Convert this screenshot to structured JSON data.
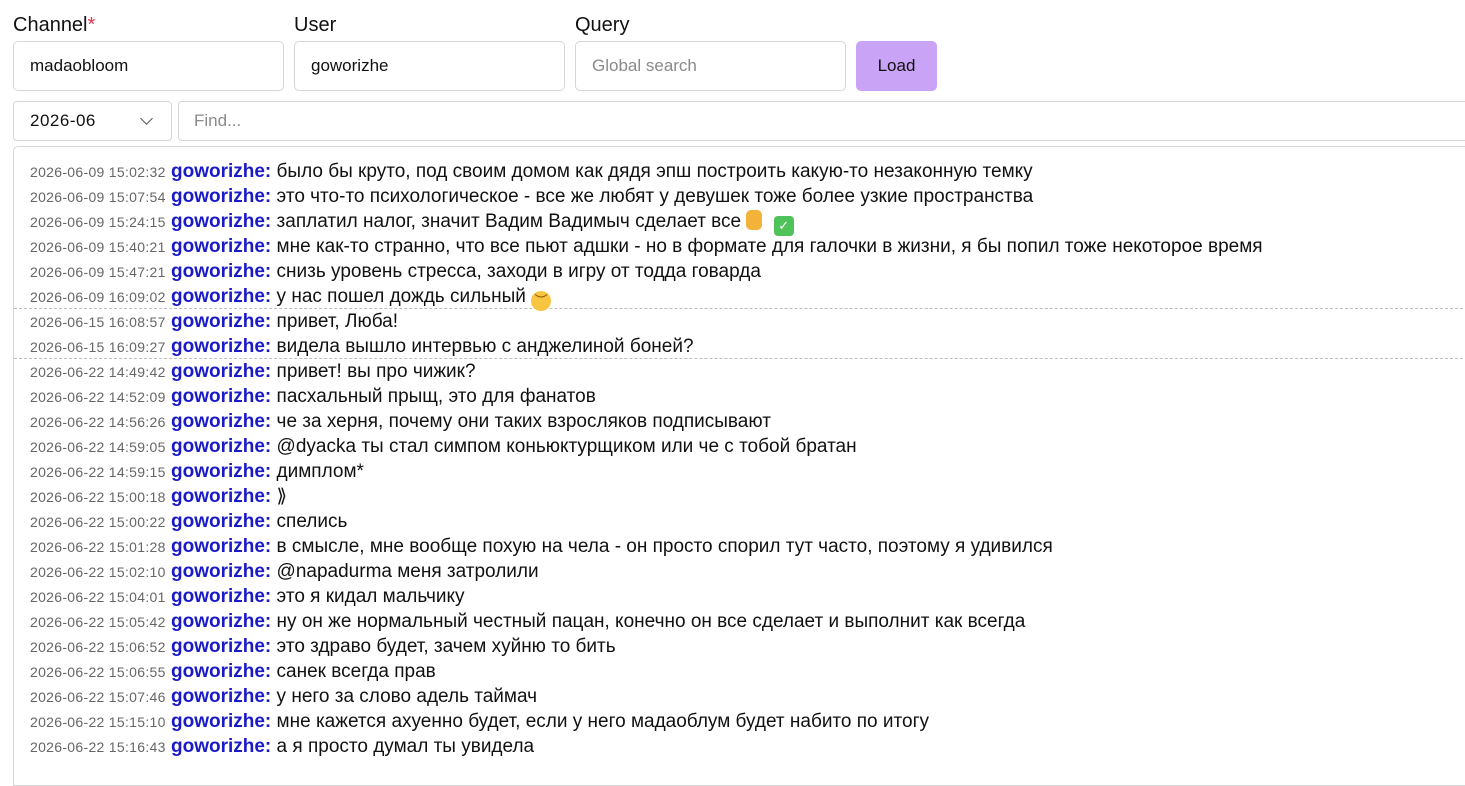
{
  "form": {
    "channel_label": "Channel",
    "channel_required_mark": "*",
    "channel_value": "madaobloom",
    "user_label": "User",
    "user_value": "goworizhe",
    "query_label": "Query",
    "query_placeholder": "Global search",
    "query_value": "",
    "load_label": "Load"
  },
  "filter": {
    "month_value": "2026-06",
    "find_placeholder": "Find..."
  },
  "colors": {
    "accent_button": "#c9a3f5",
    "username": "#1a1ac8",
    "required": "#e0364d"
  },
  "log": {
    "groups": [
      {
        "messages": [
          {
            "ts": "2026-06-09 15:02:32",
            "user": "goworizhe:",
            "text": "было бы круто, под своим домом как дядя эпш построить какую-то незаконную темку"
          },
          {
            "ts": "2026-06-09 15:07:54",
            "user": "goworizhe:",
            "text": "это что-то психологическое - все же любят у девушек тоже более узкие пространства"
          },
          {
            "ts": "2026-06-09 15:24:15",
            "user": "goworizhe:",
            "text": "заплатил налог, значит Вадим Вадимыч сделает все",
            "emoji": [
              "thumbs-up-emoji",
              "check-mark-emoji"
            ]
          },
          {
            "ts": "2026-06-09 15:40:21",
            "user": "goworizhe:",
            "text": "мне как-то странно, что все пьют адшки - но в формате для галочки в жизни, я бы попил тоже некоторое время"
          },
          {
            "ts": "2026-06-09 15:47:21",
            "user": "goworizhe:",
            "text": "снизь уровень стресса, заходи в игру от тодда говарда"
          },
          {
            "ts": "2026-06-09 16:09:02",
            "user": "goworizhe:",
            "text": "у нас пошел дождь сильный",
            "emoji": [
              "pensive-face-emoji"
            ]
          }
        ]
      },
      {
        "messages": [
          {
            "ts": "2026-06-15 16:08:57",
            "user": "goworizhe:",
            "text": "привет, Люба!"
          },
          {
            "ts": "2026-06-15 16:09:27",
            "user": "goworizhe:",
            "text": "видела вышло интервью с анджелиной боней?"
          }
        ]
      },
      {
        "messages": [
          {
            "ts": "2026-06-22 14:49:42",
            "user": "goworizhe:",
            "text": "привет! вы про чижик?"
          },
          {
            "ts": "2026-06-22 14:52:09",
            "user": "goworizhe:",
            "text": "пасхальный прыщ, это для фанатов"
          },
          {
            "ts": "2026-06-22 14:56:26",
            "user": "goworizhe:",
            "text": "че за херня, почему они таких взросляков подписывают"
          },
          {
            "ts": "2026-06-22 14:59:05",
            "user": "goworizhe:",
            "text": "@dyacka ты стал симпом коньюктурщиком или че с тобой братан"
          },
          {
            "ts": "2026-06-22 14:59:15",
            "user": "goworizhe:",
            "text": "димплом*"
          },
          {
            "ts": "2026-06-22 15:00:18",
            "user": "goworizhe:",
            "text": "⟫"
          },
          {
            "ts": "2026-06-22 15:00:22",
            "user": "goworizhe:",
            "text": "спелись"
          },
          {
            "ts": "2026-06-22 15:01:28",
            "user": "goworizhe:",
            "text": "в смысле, мне вообще похую на чела - он просто спорил тут часто, поэтому я удивился"
          },
          {
            "ts": "2026-06-22 15:02:10",
            "user": "goworizhe:",
            "text": "@napadurma меня затролили"
          },
          {
            "ts": "2026-06-22 15:04:01",
            "user": "goworizhe:",
            "text": "это я кидал мальчику"
          },
          {
            "ts": "2026-06-22 15:05:42",
            "user": "goworizhe:",
            "text": "ну он же нормальный честный пацан, конечно он все сделает и выполнит как всегда"
          },
          {
            "ts": "2026-06-22 15:06:52",
            "user": "goworizhe:",
            "text": "это здраво будет, зачем хуйню то бить"
          },
          {
            "ts": "2026-06-22 15:06:55",
            "user": "goworizhe:",
            "text": "санек всегда прав"
          },
          {
            "ts": "2026-06-22 15:07:46",
            "user": "goworizhe:",
            "text": "у него за слово адель таймач"
          },
          {
            "ts": "2026-06-22 15:15:10",
            "user": "goworizhe:",
            "text": "мне кажется ахуенно будет, если у него мадаоблум будет набито по итогу"
          },
          {
            "ts": "2026-06-22 15:16:43",
            "user": "goworizhe:",
            "text": "а я просто думал ты увидела"
          }
        ]
      }
    ]
  }
}
